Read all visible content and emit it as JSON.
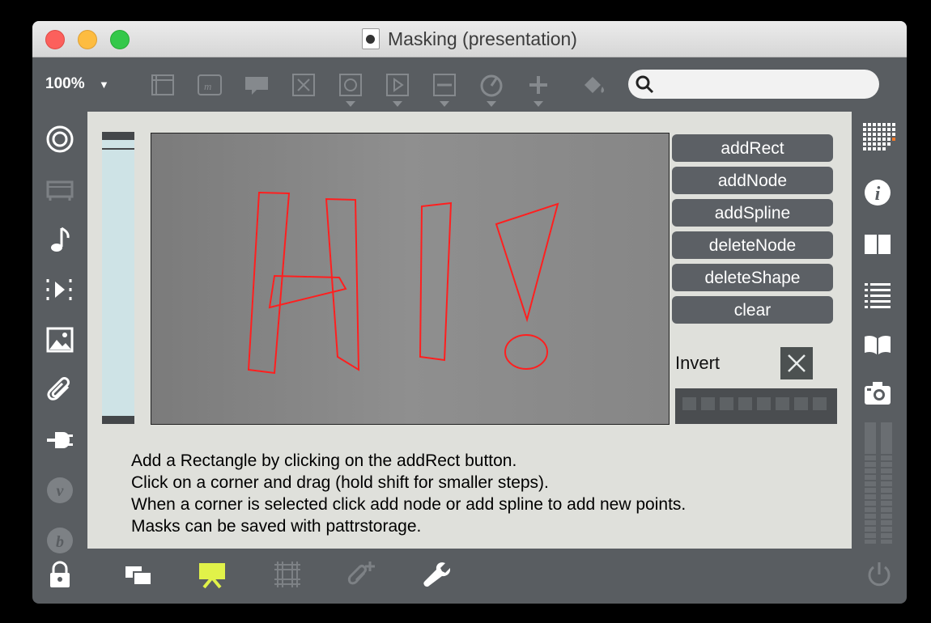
{
  "window": {
    "title": "Masking (presentation)"
  },
  "toolbar": {
    "zoom": "100%",
    "search_placeholder": ""
  },
  "colors": {
    "accent": "#e1f249",
    "canvas_bg": "#dfe0db",
    "button_bg": "#5c6065",
    "sidebar_bg": "#595d61",
    "shape_stroke": "#ff1f1f"
  },
  "toolbar_icons": [
    "object-box-icon",
    "message-icon",
    "comment-icon",
    "toggle-icon",
    "button-icon",
    "play-icon",
    "slider-icon",
    "dial-icon",
    "add-icon",
    "paint-bucket-icon"
  ],
  "left_sidebar_icons": [
    "target-icon",
    "device-icon",
    "music-note-icon",
    "media-icon",
    "image-icon",
    "paperclip-icon",
    "plug-icon",
    "vizzie-icon",
    "help-icon"
  ],
  "right_sidebar_icons": [
    "grid-icon",
    "info-icon",
    "columns-icon",
    "list-icon",
    "book-icon",
    "camera-icon",
    "meter-icon",
    "power-icon"
  ],
  "bottom_icons": [
    "lock-icon",
    "windows-icon",
    "presentation-icon",
    "grid-icon",
    "paperclip-add-icon",
    "wrench-icon"
  ],
  "buttons": [
    "addRect",
    "addNode",
    "addSpline",
    "deleteNode",
    "deleteShape",
    "clear"
  ],
  "invert": {
    "label": "Invert",
    "checked": true
  },
  "help_text": [
    "Add a Rectangle by clicking on the addRect button.",
    "Click on a corner and drag (hold shift for smaller steps).",
    "When a corner is selected click add node or add spline to add new points.",
    "Masks can be saved with pattrstorage."
  ]
}
